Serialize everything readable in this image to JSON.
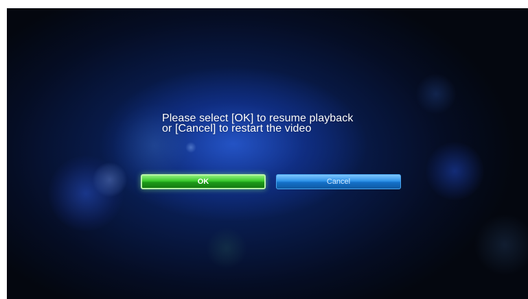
{
  "dialog": {
    "message_line1": "Please select [OK] to resume playback",
    "message_line2": "or [Cancel] to restart the video",
    "ok_label": "OK",
    "cancel_label": "Cancel"
  },
  "colors": {
    "background": "#081a48",
    "ok_button": "#37c72b",
    "cancel_button": "#2f93e8",
    "text": "#ffffff"
  }
}
